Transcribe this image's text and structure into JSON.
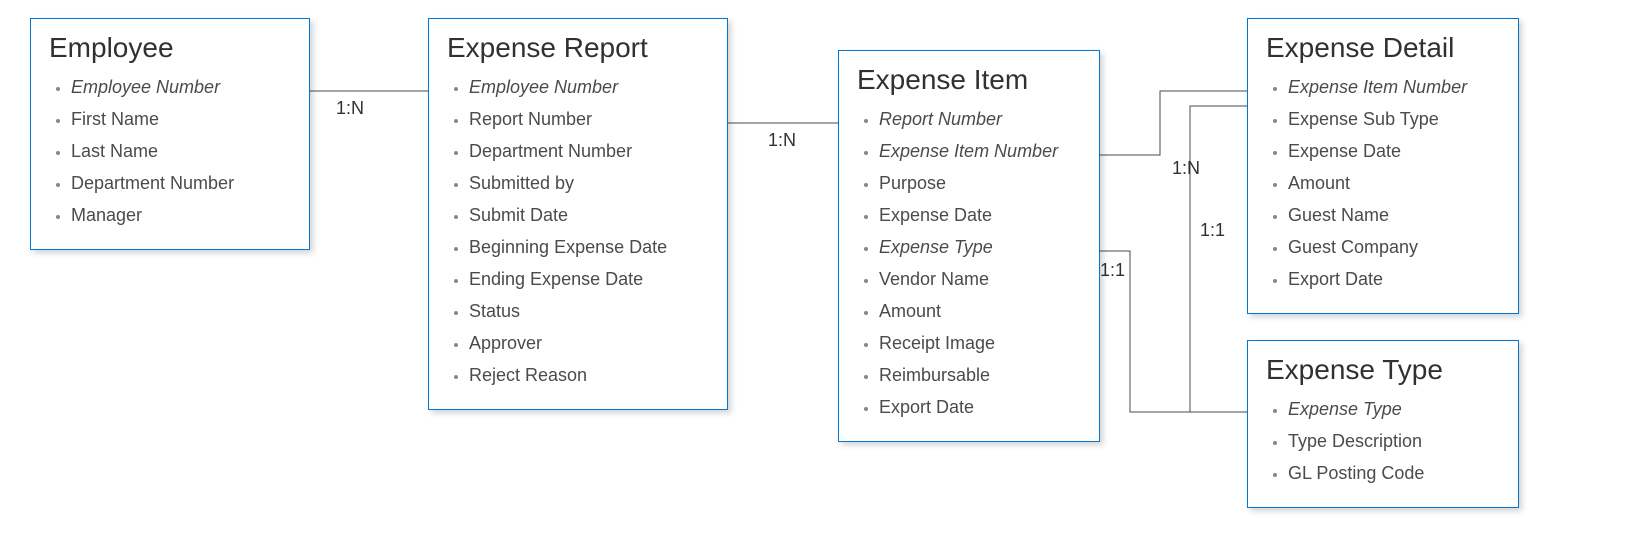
{
  "entities": {
    "employee": {
      "title": "Employee",
      "fields": [
        {
          "label": "Employee Number",
          "key": true
        },
        {
          "label": "First Name",
          "key": false
        },
        {
          "label": "Last Name",
          "key": false
        },
        {
          "label": "Department Number",
          "key": false
        },
        {
          "label": "Manager",
          "key": false
        }
      ]
    },
    "expense_report": {
      "title": "Expense Report",
      "fields": [
        {
          "label": "Employee Number",
          "key": true
        },
        {
          "label": "Report Number",
          "key": false
        },
        {
          "label": "Department Number",
          "key": false
        },
        {
          "label": "Submitted by",
          "key": false
        },
        {
          "label": "Submit Date",
          "key": false
        },
        {
          "label": "Beginning Expense Date",
          "key": false
        },
        {
          "label": "Ending Expense Date",
          "key": false
        },
        {
          "label": "Status",
          "key": false
        },
        {
          "label": "Approver",
          "key": false
        },
        {
          "label": "Reject Reason",
          "key": false
        }
      ]
    },
    "expense_item": {
      "title": "Expense Item",
      "fields": [
        {
          "label": "Report Number",
          "key": true
        },
        {
          "label": "Expense Item Number",
          "key": true
        },
        {
          "label": "Purpose",
          "key": false
        },
        {
          "label": "Expense Date",
          "key": false
        },
        {
          "label": "Expense Type",
          "key": true
        },
        {
          "label": "Vendor Name",
          "key": false
        },
        {
          "label": "Amount",
          "key": false
        },
        {
          "label": "Receipt Image",
          "key": false
        },
        {
          "label": "Reimbursable",
          "key": false
        },
        {
          "label": "Export Date",
          "key": false
        }
      ]
    },
    "expense_detail": {
      "title": "Expense Detail",
      "fields": [
        {
          "label": "Expense Item Number",
          "key": true
        },
        {
          "label": "Expense Sub Type",
          "key": false
        },
        {
          "label": "Expense Date",
          "key": false
        },
        {
          "label": "Amount",
          "key": false
        },
        {
          "label": "Guest Name",
          "key": false
        },
        {
          "label": "Guest Company",
          "key": false
        },
        {
          "label": "Export Date",
          "key": false
        }
      ]
    },
    "expense_type": {
      "title": "Expense Type",
      "fields": [
        {
          "label": "Expense Type",
          "key": true
        },
        {
          "label": "Type Description",
          "key": false
        },
        {
          "label": "GL Posting Code",
          "key": false
        }
      ]
    }
  },
  "relations": {
    "r1": "1:N",
    "r2": "1:N",
    "r3": "1:N",
    "r4": "1:1",
    "r5": "1:1"
  }
}
